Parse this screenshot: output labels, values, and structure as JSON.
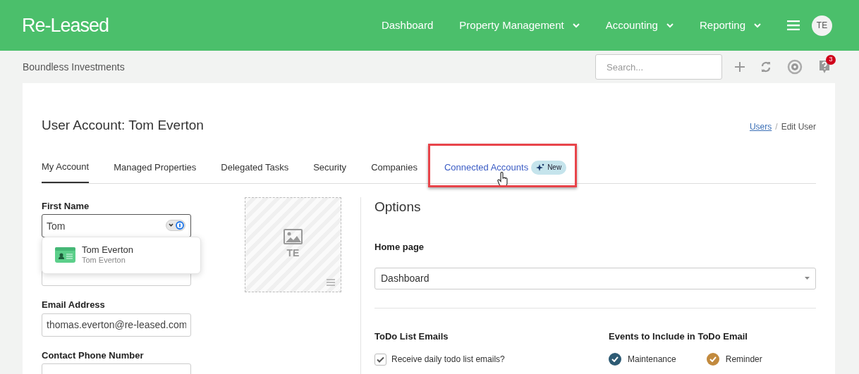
{
  "header": {
    "logo": "Re-Leased",
    "nav": [
      {
        "label": "Dashboard",
        "dropdown": false
      },
      {
        "label": "Property Management",
        "dropdown": true
      },
      {
        "label": "Accounting",
        "dropdown": true
      },
      {
        "label": "Reporting",
        "dropdown": true
      }
    ],
    "avatar": "TE"
  },
  "subbar": {
    "company": "Boundless Investments",
    "search": {
      "placeholder": "Search..."
    },
    "help_badge": "3"
  },
  "page": {
    "title": "User Account: Tom Everton",
    "breadcrumb": [
      {
        "label": "Users",
        "link": true
      },
      {
        "separator": "/"
      },
      {
        "label": "Edit User",
        "link": false
      }
    ]
  },
  "tabs": [
    {
      "label": "My Account",
      "selected": true,
      "highlighted": false
    },
    {
      "label": "Managed Properties",
      "selected": false,
      "highlighted": false
    },
    {
      "label": "Delegated Tasks",
      "selected": false,
      "highlighted": false
    },
    {
      "label": "Security",
      "selected": false,
      "highlighted": false
    },
    {
      "label": "Companies",
      "selected": false,
      "highlighted": false
    },
    {
      "label": "Connected Accounts",
      "selected": false,
      "highlighted": true,
      "badge": "New"
    }
  ],
  "fields": [
    {
      "label": "First Name",
      "value": "Tom",
      "focused": true
    },
    {
      "focused": false
    },
    {
      "label": "Email Address",
      "value": "thomas.everton@re-leased.com",
      "focused": false
    },
    {
      "label": "Contact Phone Number",
      "focused": false
    }
  ],
  "autofill": {
    "name": "Tom Everton",
    "detail": "Tom Everton"
  },
  "photo": {
    "initials": "TE"
  },
  "options": {
    "title": "Options",
    "home_page": {
      "label": "Home page",
      "value": "Dashboard"
    },
    "todo": {
      "title": "ToDo List Emails",
      "items": [
        {
          "label": "Receive daily todo list emails?",
          "checked": true
        }
      ]
    },
    "events": {
      "title": "Events to Include in ToDo Email",
      "items": [
        {
          "label": "Maintenance",
          "checked": true,
          "color": "#2e5b74"
        },
        {
          "label": "Reminder",
          "checked": true,
          "color": "#c28a3e"
        }
      ]
    }
  }
}
